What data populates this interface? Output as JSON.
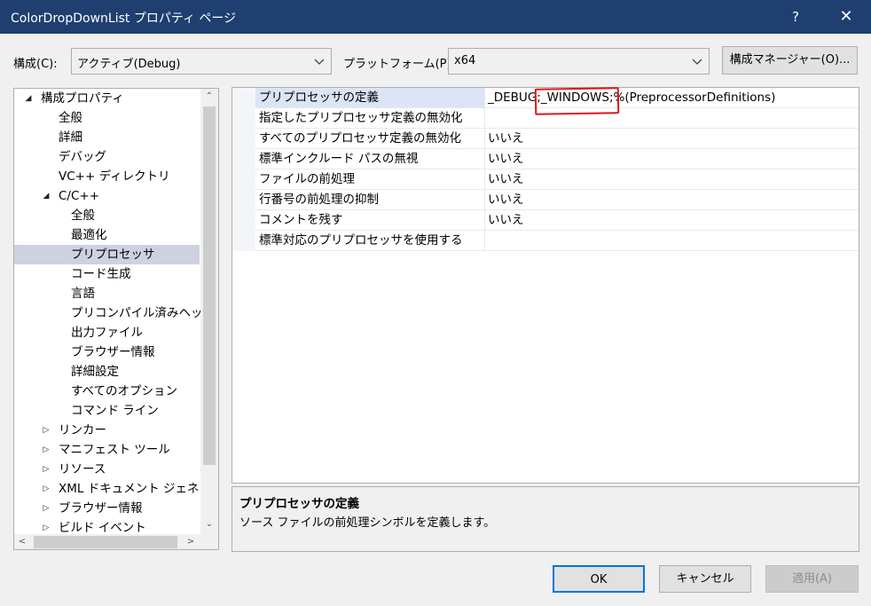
{
  "window": {
    "title": "ColorDropDownList プロパティ ページ",
    "help": "?",
    "close": "✕"
  },
  "config": {
    "label": "構成(C):",
    "value": "アクティブ(Debug)",
    "platform_label": "プラットフォーム(P):",
    "platform_value": "x64",
    "manager_button": "構成マネージャー(O)..."
  },
  "tree": {
    "items": [
      {
        "label": "構成プロパティ",
        "expander": "◢",
        "level": 0,
        "selected": false
      },
      {
        "label": "全般",
        "expander": "",
        "level": 1,
        "selected": false
      },
      {
        "label": "詳細",
        "expander": "",
        "level": 1,
        "selected": false
      },
      {
        "label": "デバッグ",
        "expander": "",
        "level": 1,
        "selected": false
      },
      {
        "label": "VC++ ディレクトリ",
        "expander": "",
        "level": 1,
        "selected": false
      },
      {
        "label": "C/C++",
        "expander": "◢",
        "level": 1,
        "selected": false
      },
      {
        "label": "全般",
        "expander": "",
        "level": 2,
        "selected": false
      },
      {
        "label": "最適化",
        "expander": "",
        "level": 2,
        "selected": false
      },
      {
        "label": "プリプロセッサ",
        "expander": "",
        "level": 2,
        "selected": true
      },
      {
        "label": "コード生成",
        "expander": "",
        "level": 2,
        "selected": false
      },
      {
        "label": "言語",
        "expander": "",
        "level": 2,
        "selected": false
      },
      {
        "label": "プリコンパイル済みヘッダー",
        "expander": "",
        "level": 2,
        "selected": false
      },
      {
        "label": "出力ファイル",
        "expander": "",
        "level": 2,
        "selected": false
      },
      {
        "label": "ブラウザー情報",
        "expander": "",
        "level": 2,
        "selected": false
      },
      {
        "label": "詳細設定",
        "expander": "",
        "level": 2,
        "selected": false
      },
      {
        "label": "すべてのオプション",
        "expander": "",
        "level": 2,
        "selected": false
      },
      {
        "label": "コマンド ライン",
        "expander": "",
        "level": 2,
        "selected": false
      },
      {
        "label": "リンカー",
        "expander": "▷",
        "level": 1,
        "selected": false
      },
      {
        "label": "マニフェスト ツール",
        "expander": "▷",
        "level": 1,
        "selected": false
      },
      {
        "label": "リソース",
        "expander": "▷",
        "level": 1,
        "selected": false
      },
      {
        "label": "XML ドキュメント ジェネレータ",
        "expander": "▷",
        "level": 1,
        "selected": false
      },
      {
        "label": "ブラウザー情報",
        "expander": "▷",
        "level": 1,
        "selected": false
      },
      {
        "label": "ビルド イベント",
        "expander": "▷",
        "level": 1,
        "selected": false
      }
    ]
  },
  "properties": [
    {
      "name": "プリプロセッサの定義",
      "value": "_DEBUG;_WINDOWS;%(PreprocessorDefinitions)",
      "selected": true
    },
    {
      "name": "指定したプリプロセッサ定義の無効化",
      "value": "",
      "selected": false
    },
    {
      "name": "すべてのプリプロセッサ定義の無効化",
      "value": "いいえ",
      "selected": false
    },
    {
      "name": "標準インクルード パスの無視",
      "value": "いいえ",
      "selected": false
    },
    {
      "name": "ファイルの前処理",
      "value": "いいえ",
      "selected": false
    },
    {
      "name": "行番号の前処理の抑制",
      "value": "いいえ",
      "selected": false
    },
    {
      "name": "コメントを残す",
      "value": "いいえ",
      "selected": false
    },
    {
      "name": "標準対応のプリプロセッサを使用する",
      "value": "",
      "selected": false
    }
  ],
  "description": {
    "title": "プリプロセッサの定義",
    "text": "ソース ファイルの前処理シンボルを定義します。"
  },
  "buttons": {
    "ok": "OK",
    "cancel": "キャンセル",
    "apply": "適用(A)"
  }
}
